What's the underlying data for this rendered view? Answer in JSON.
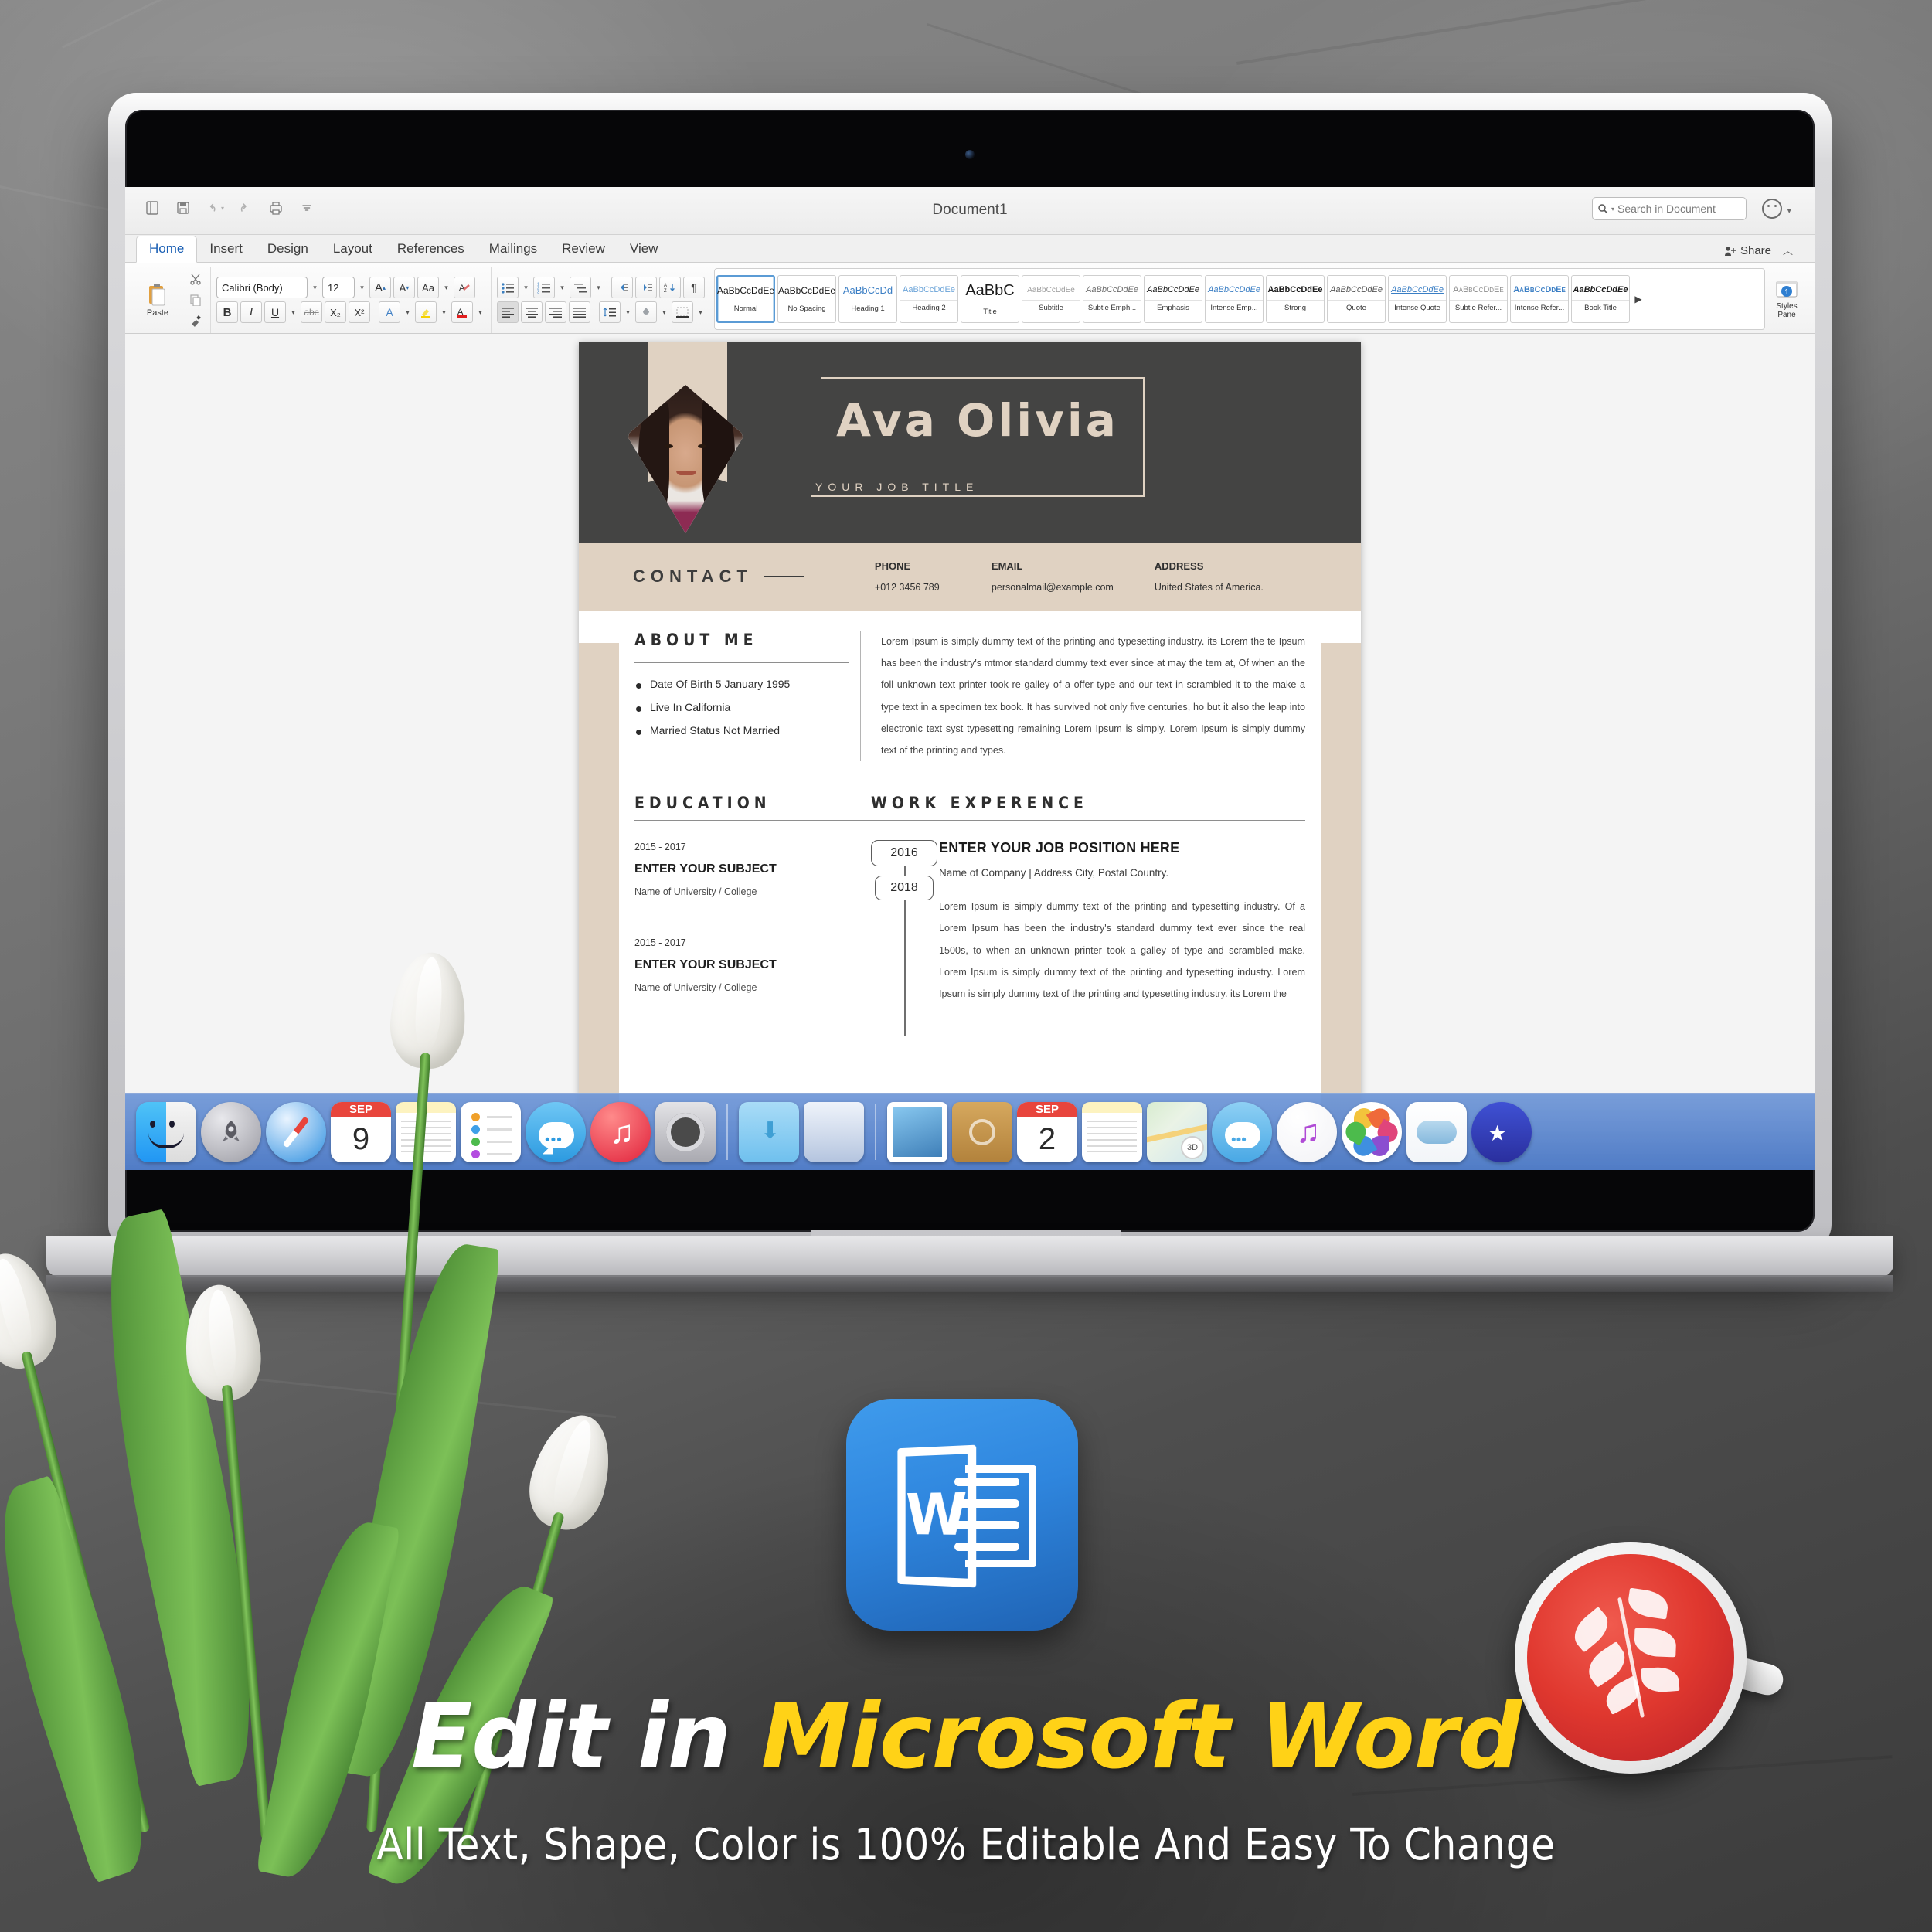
{
  "background": {
    "surface_color": "#6e6e6e"
  },
  "word_window": {
    "title": "Document1",
    "quick_access": [
      "new-icon",
      "save-icon",
      "undo-icon",
      "redo-icon",
      "print-icon",
      "customize-icon"
    ],
    "search": {
      "placeholder": "Search in Document",
      "icon": "search-icon"
    },
    "account_icon": "smiley-icon",
    "share_label": "Share",
    "tabs": [
      {
        "label": "Home",
        "active": true
      },
      {
        "label": "Insert",
        "active": false
      },
      {
        "label": "Design",
        "active": false
      },
      {
        "label": "Layout",
        "active": false
      },
      {
        "label": "References",
        "active": false
      },
      {
        "label": "Mailings",
        "active": false
      },
      {
        "label": "Review",
        "active": false
      },
      {
        "label": "View",
        "active": false
      }
    ],
    "ribbon": {
      "clipboard": {
        "paste_label": "Paste",
        "cut_icon": "scissors-icon",
        "copy_icon": "copy-icon",
        "format_painter_icon": "paintbrush-icon"
      },
      "font": {
        "font_name": "Calibri (Body)",
        "font_size": "12",
        "grow_icon": "increase-font-icon",
        "shrink_icon": "decrease-font-icon",
        "change_case_icon": "change-case-icon",
        "clear_formatting_icon": "clear-formatting-icon",
        "bold": "B",
        "italic": "I",
        "underline": "U",
        "strikethrough": "abc",
        "subscript": "X₂",
        "superscript": "X²",
        "text_effects_icon": "text-effects-icon",
        "highlight_icon": "highlight-icon",
        "font_color_icon": "font-color-icon"
      },
      "paragraph": {
        "bullets_icon": "bullet-list-icon",
        "numbering_icon": "numbered-list-icon",
        "multilevel_icon": "multilevel-list-icon",
        "decrease_indent_icon": "decrease-indent-icon",
        "increase_indent_icon": "increase-indent-icon",
        "sort_icon": "sort-icon",
        "show_marks_icon": "paragraph-mark-icon",
        "align_left_icon": "align-left-icon",
        "align_center_icon": "align-center-icon",
        "align_right_icon": "align-right-icon",
        "justify_icon": "justify-icon",
        "line_spacing_icon": "line-spacing-icon",
        "shading_icon": "shading-icon",
        "borders_icon": "borders-icon"
      },
      "styles": [
        {
          "preview": "AaBbCcDdEe",
          "name": "Normal",
          "selected": true
        },
        {
          "preview": "AaBbCcDdEe",
          "name": "No Spacing",
          "selected": false
        },
        {
          "preview": "AaBbCcDd",
          "name": "Heading 1",
          "selected": false
        },
        {
          "preview": "AaBbCcDdEe",
          "name": "Heading 2",
          "selected": false
        },
        {
          "preview": "AaBbC",
          "name": "Title",
          "selected": false
        },
        {
          "preview": "AaBbCcDdEe",
          "name": "Subtitle",
          "selected": false
        },
        {
          "preview": "AaBbCcDdEe",
          "name": "Subtle Emph...",
          "selected": false
        },
        {
          "preview": "AaBbCcDdEe",
          "name": "Emphasis",
          "selected": false
        },
        {
          "preview": "AaBbCcDdEe",
          "name": "Intense Emp...",
          "selected": false
        },
        {
          "preview": "AaBbCcDdEe",
          "name": "Strong",
          "selected": false
        },
        {
          "preview": "AaBbCcDdEe",
          "name": "Quote",
          "selected": false
        },
        {
          "preview": "AaBbCcDdEe",
          "name": "Intense Quote",
          "selected": false
        },
        {
          "preview": "AaBbCcDdEe",
          "name": "Subtle Refer...",
          "selected": false
        },
        {
          "preview": "AaBbCcDdEe",
          "name": "Intense Refer...",
          "selected": false
        },
        {
          "preview": "AaBbCcDdEe",
          "name": "Book Title",
          "selected": false
        }
      ],
      "gallery_more_icon": "chevron-right-icon",
      "styles_pane_label_line1": "Styles",
      "styles_pane_label_line2": "Pane"
    }
  },
  "resume": {
    "name": "Ava Olivia",
    "job_title": "YOUR JOB TITLE",
    "contact": {
      "section_label": "CONTACT",
      "fields": [
        {
          "key": "PHONE",
          "value": "+012 3456 789"
        },
        {
          "key": "EMAIL",
          "value": "personalmail@example.com"
        },
        {
          "key": "ADDRESS",
          "value": "United States of America."
        }
      ]
    },
    "about": {
      "title": "ABOUT ME",
      "bullets": [
        "Date Of Birth 5 January 1995",
        "Live In California",
        "Married Status Not Married"
      ],
      "paragraph": "Lorem Ipsum is simply dummy text of the printing and typesetting industry. its Lorem the te Ipsum has been the industry's mtmor standard dummy text ever since at may the tem at, Of when an the foll unknown text printer took re galley of a offer type and our text in scrambled it to the make a type text in a specimen tex book. It has survived not only five centuries, ho but it also the leap into electronic text syst typesetting remaining Lorem Ipsum is simply. Lorem Ipsum is simply dummy text of the printing and types."
    },
    "education": {
      "title": "EDUCATION",
      "items": [
        {
          "years": "2015 - 2017",
          "subject": "ENTER YOUR SUBJECT",
          "school": "Name of University / College"
        },
        {
          "years": "2015 - 2017",
          "subject": "ENTER YOUR SUBJECT",
          "school": "Name of University / College"
        }
      ]
    },
    "work": {
      "title": "WORK EXPERENCE",
      "year_start": "2016",
      "year_end": "2018",
      "position": "ENTER YOUR JOB POSITION HERE",
      "company": "Name of Company | Address City, Postal Country.",
      "description": "Lorem Ipsum is simply dummy text of the printing and typesetting industry. Of a Lorem Ipsum has been the industry's standard dummy text ever since the real 1500s, to when an unknown printer took a galley of type and scrambled make. Lorem Ipsum is simply dummy text of the printing and typesetting industry. Lorem Ipsum is simply dummy text of the printing and typesetting industry. its Lorem the"
    },
    "colors": {
      "dark": "#444443",
      "tan": "#e0d2c2"
    }
  },
  "dock": {
    "left_items": [
      {
        "name": "finder",
        "icon": "finder-icon"
      },
      {
        "name": "launchpad",
        "icon": "launchpad-icon"
      },
      {
        "name": "safari",
        "icon": "safari-icon"
      },
      {
        "name": "calendar",
        "icon": "calendar-icon",
        "month": "SEP",
        "day": "9"
      },
      {
        "name": "notes",
        "icon": "notes-icon"
      },
      {
        "name": "reminders",
        "icon": "reminders-icon"
      },
      {
        "name": "messages",
        "icon": "messages-icon"
      },
      {
        "name": "itunes",
        "icon": "itunes-icon"
      },
      {
        "name": "system-preferences",
        "icon": "gear-icon"
      }
    ],
    "right_items": [
      {
        "name": "downloads",
        "icon": "folder-icon"
      },
      {
        "name": "trash",
        "icon": "trash-icon"
      },
      {
        "name": "mail",
        "icon": "mail-icon"
      },
      {
        "name": "contacts",
        "icon": "contacts-icon"
      },
      {
        "name": "calendar-2",
        "icon": "calendar-icon",
        "month": "SEP",
        "day": "2"
      },
      {
        "name": "notes-2",
        "icon": "notes-icon"
      },
      {
        "name": "maps",
        "icon": "maps-icon",
        "badge": "3D"
      },
      {
        "name": "messages-2",
        "icon": "messages-icon"
      },
      {
        "name": "itunes-2",
        "icon": "itunes-icon"
      },
      {
        "name": "photos",
        "icon": "photos-icon"
      },
      {
        "name": "icloud-drive",
        "icon": "cloud-icon"
      },
      {
        "name": "imovie",
        "icon": "imovie-icon"
      }
    ]
  },
  "promo": {
    "word_app_icon": "microsoft-word-icon",
    "headline_white": "Edit in",
    "headline_yellow": "Microsoft Word",
    "subline": "All Text, Shape, Color is 100% Editable And Easy To Change",
    "accent_yellow": "#FFD217"
  }
}
